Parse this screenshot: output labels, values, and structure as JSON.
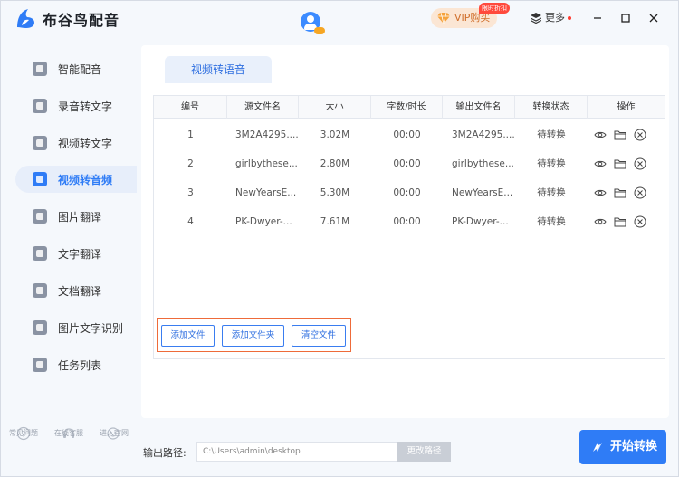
{
  "app": {
    "title": "布谷鸟配音"
  },
  "header": {
    "vip_label": "VIP购买",
    "limited_badge": "限时折扣",
    "more_label": "更多"
  },
  "sidebar": {
    "items": [
      {
        "label": "智能配音",
        "icon": "smart-dubbing-icon"
      },
      {
        "label": "录音转文字",
        "icon": "recording-to-text-icon"
      },
      {
        "label": "视频转文字",
        "icon": "video-to-text-icon"
      },
      {
        "label": "视频转音频",
        "icon": "video-to-audio-icon",
        "active": true
      },
      {
        "label": "图片翻译",
        "icon": "image-translate-icon"
      },
      {
        "label": "文字翻译",
        "icon": "text-translate-icon"
      },
      {
        "label": "文档翻译",
        "icon": "doc-translate-icon"
      },
      {
        "label": "图片文字识别",
        "icon": "ocr-icon"
      },
      {
        "label": "任务列表",
        "icon": "task-list-icon"
      }
    ],
    "footer": [
      {
        "label": "常见问题",
        "icon": "faq-icon"
      },
      {
        "label": "在线客服",
        "icon": "support-icon"
      },
      {
        "label": "进入官网",
        "icon": "website-icon"
      }
    ]
  },
  "main": {
    "tab_label": "视频转语音",
    "table": {
      "headers": [
        "编号",
        "源文件名",
        "大小",
        "字数/时长",
        "输出文件名",
        "转换状态",
        "操作"
      ],
      "rows": [
        {
          "index": "1",
          "source": "3M2A4295....",
          "size": "3.02M",
          "duration": "00:00",
          "output": "3M2A4295....",
          "status": "待转换"
        },
        {
          "index": "2",
          "source": "girlbythese...",
          "size": "2.80M",
          "duration": "00:00",
          "output": "girlbythese...",
          "status": "待转换"
        },
        {
          "index": "3",
          "source": "NewYearsE...",
          "size": "5.30M",
          "duration": "00:00",
          "output": "NewYearsE...",
          "status": "待转换"
        },
        {
          "index": "4",
          "source": "PK-Dwyer-...",
          "size": "7.61M",
          "duration": "00:00",
          "output": "PK-Dwyer-...",
          "status": "待转换"
        }
      ]
    },
    "buttons": {
      "add_file": "添加文件",
      "add_folder": "添加文件夹",
      "clear_files": "清空文件"
    }
  },
  "bottom": {
    "output_label": "输出路径:",
    "output_path": "C:\\Users\\admin\\desktop",
    "change_path": "更改路径",
    "start": "开始转换"
  },
  "colors": {
    "accent": "#2f7cf6",
    "highlight_border": "#ee6b3a",
    "vip_bg": "#fbe6d4"
  }
}
